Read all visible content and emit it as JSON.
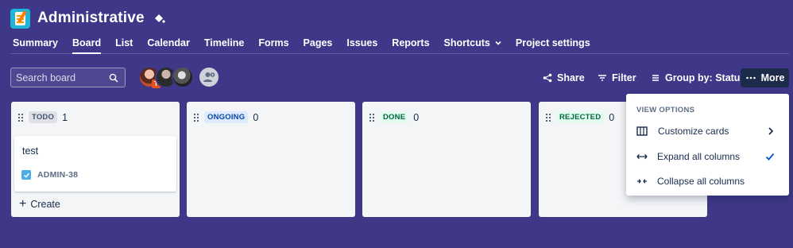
{
  "project": {
    "title": "Administrative",
    "icon": "notepad-icon",
    "action_icon": "paint-bucket-icon"
  },
  "nav": {
    "items": [
      {
        "label": "Summary"
      },
      {
        "label": "Board",
        "active": true
      },
      {
        "label": "List"
      },
      {
        "label": "Calendar"
      },
      {
        "label": "Timeline"
      },
      {
        "label": "Forms"
      },
      {
        "label": "Pages"
      },
      {
        "label": "Issues"
      },
      {
        "label": "Reports"
      },
      {
        "label": "Shortcuts",
        "dropdown": true
      },
      {
        "label": "Project settings"
      }
    ]
  },
  "toolbar": {
    "search_placeholder": "Search board",
    "avatar_badge": "T",
    "share_label": "Share",
    "filter_label": "Filter",
    "group_label": "Group by: Status",
    "more_label": "More"
  },
  "columns": [
    {
      "status": "TODO",
      "count": "1",
      "lozenge_color": "#dfe1e6"
    },
    {
      "status": "ONGOING",
      "count": "0",
      "lozenge_color": "#deebff"
    },
    {
      "status": "DONE",
      "count": "0",
      "lozenge_color": "#e3fcef"
    },
    {
      "status": "REJECTED",
      "count": "0",
      "lozenge_color": "#e3fcef"
    }
  ],
  "card": {
    "title": "test",
    "key": "ADMIN-38",
    "type_icon": "task-checkbox-icon"
  },
  "create_label": "Create",
  "view_options": {
    "section_title": "VIEW OPTIONS",
    "items": [
      {
        "label": "Customize cards",
        "icon": "columns-icon",
        "trailing": "chevron-right-icon"
      },
      {
        "label": "Expand all columns",
        "icon": "expand-arrows-icon",
        "trailing": "checkmark-icon",
        "checked": true
      },
      {
        "label": "Collapse all columns",
        "icon": "collapse-arrows-icon"
      }
    ]
  },
  "colors": {
    "background": "#3f3888",
    "more_button": "#1c2b4a",
    "accent": "#0052cc"
  }
}
